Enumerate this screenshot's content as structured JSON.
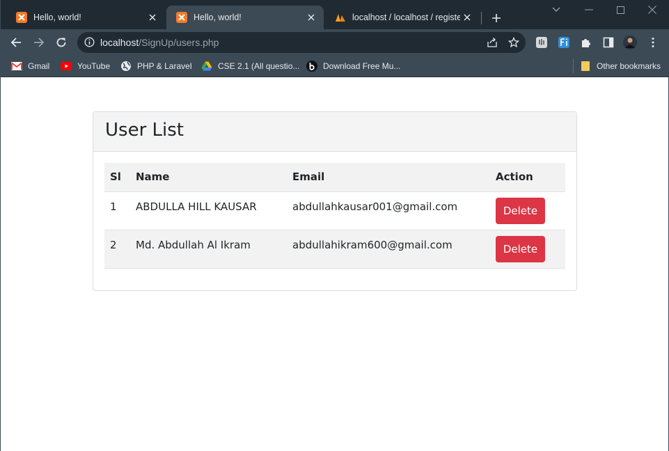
{
  "browser": {
    "tabs": [
      {
        "title": "Hello, world!",
        "active": false
      },
      {
        "title": "Hello, world!",
        "active": true
      },
      {
        "title": "localhost / localhost / register_"
      }
    ],
    "url": {
      "host": "localhost",
      "path": "/SignUp/users.php"
    },
    "bookmarks": [
      {
        "label": "Gmail"
      },
      {
        "label": "YouTube"
      },
      {
        "label": "PHP & Laravel"
      },
      {
        "label": "CSE 2.1 (All questio..."
      },
      {
        "label": "Download Free Mu..."
      }
    ],
    "other_bookmarks": "Other bookmarks"
  },
  "page": {
    "card_title": "User List",
    "columns": [
      "Sl",
      "Name",
      "Email",
      "Action"
    ],
    "rows": [
      {
        "sl": "1",
        "name": "ABDULLA HILL KAUSAR",
        "email": "abdullahkausar001@gmail.com",
        "action": "Delete"
      },
      {
        "sl": "2",
        "name": "Md. Abdullah Al Ikram",
        "email": "abdullahikram600@gmail.com",
        "action": "Delete"
      }
    ]
  },
  "colors": {
    "delete_button": "#dc3545",
    "chrome_dark": "#202a32",
    "chrome_toolbar": "#3b4a55"
  }
}
